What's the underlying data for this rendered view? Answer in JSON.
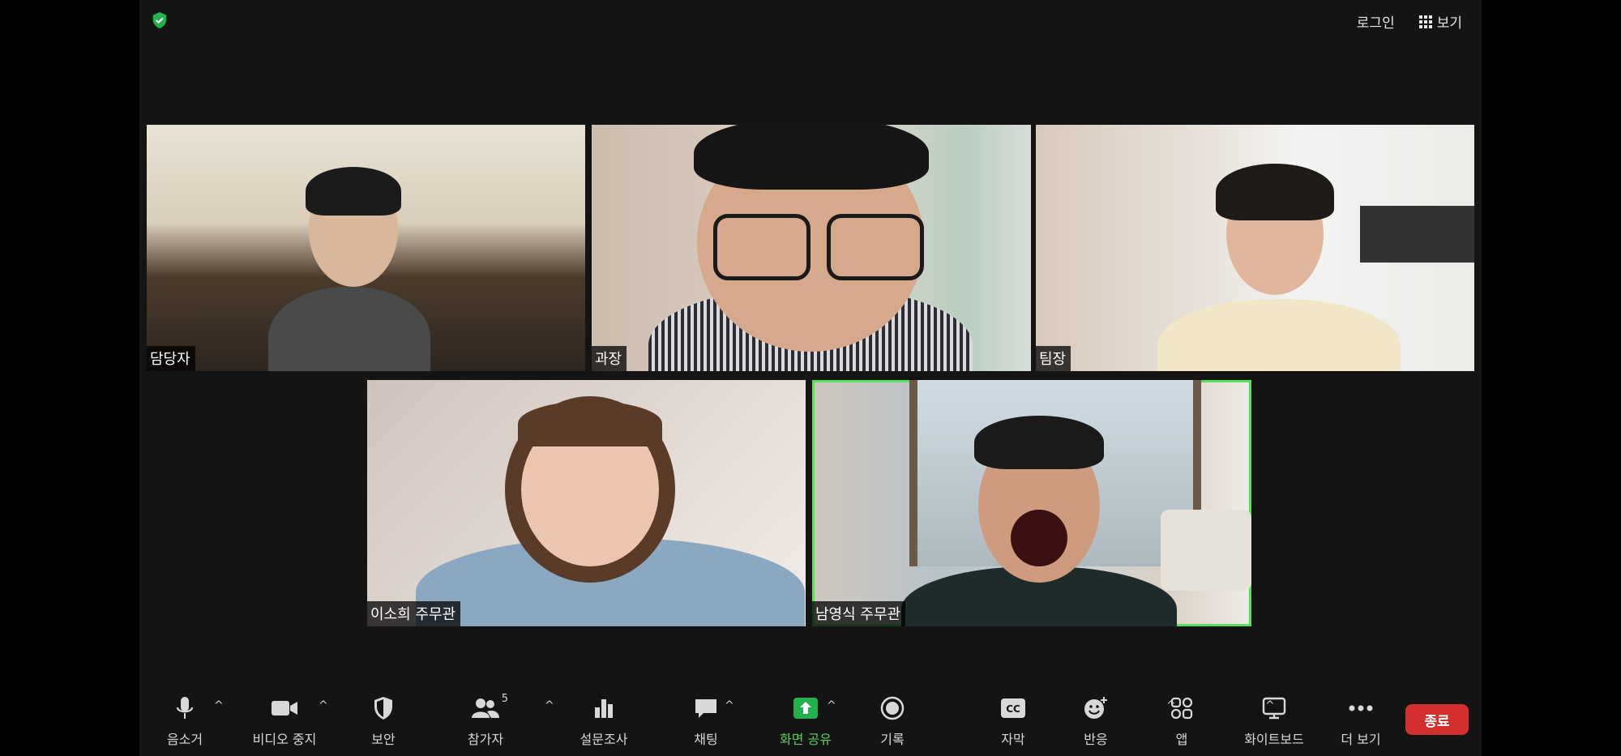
{
  "topbar": {
    "login_label": "로그인",
    "view_label": "보기"
  },
  "participants": [
    {
      "name": "담당자"
    },
    {
      "name": "과장"
    },
    {
      "name": "팀장"
    },
    {
      "name": "이소희 주무관"
    },
    {
      "name": "남영식 주무관"
    }
  ],
  "toolbar": {
    "mute_label": "음소거",
    "video_label": "비디오 중지",
    "security_label": "보안",
    "participants_label": "참가자",
    "participants_count": "5",
    "polls_label": "설문조사",
    "chat_label": "채팅",
    "share_label": "화면 공유",
    "record_label": "기록",
    "captions_label": "자막",
    "reactions_label": "반응",
    "apps_label": "앱",
    "whiteboard_label": "화이트보드",
    "more_label": "더 보기",
    "end_label": "종료"
  },
  "colors": {
    "accent_green": "#5ad05a",
    "end_red": "#d32f2f",
    "background": "#141414"
  }
}
